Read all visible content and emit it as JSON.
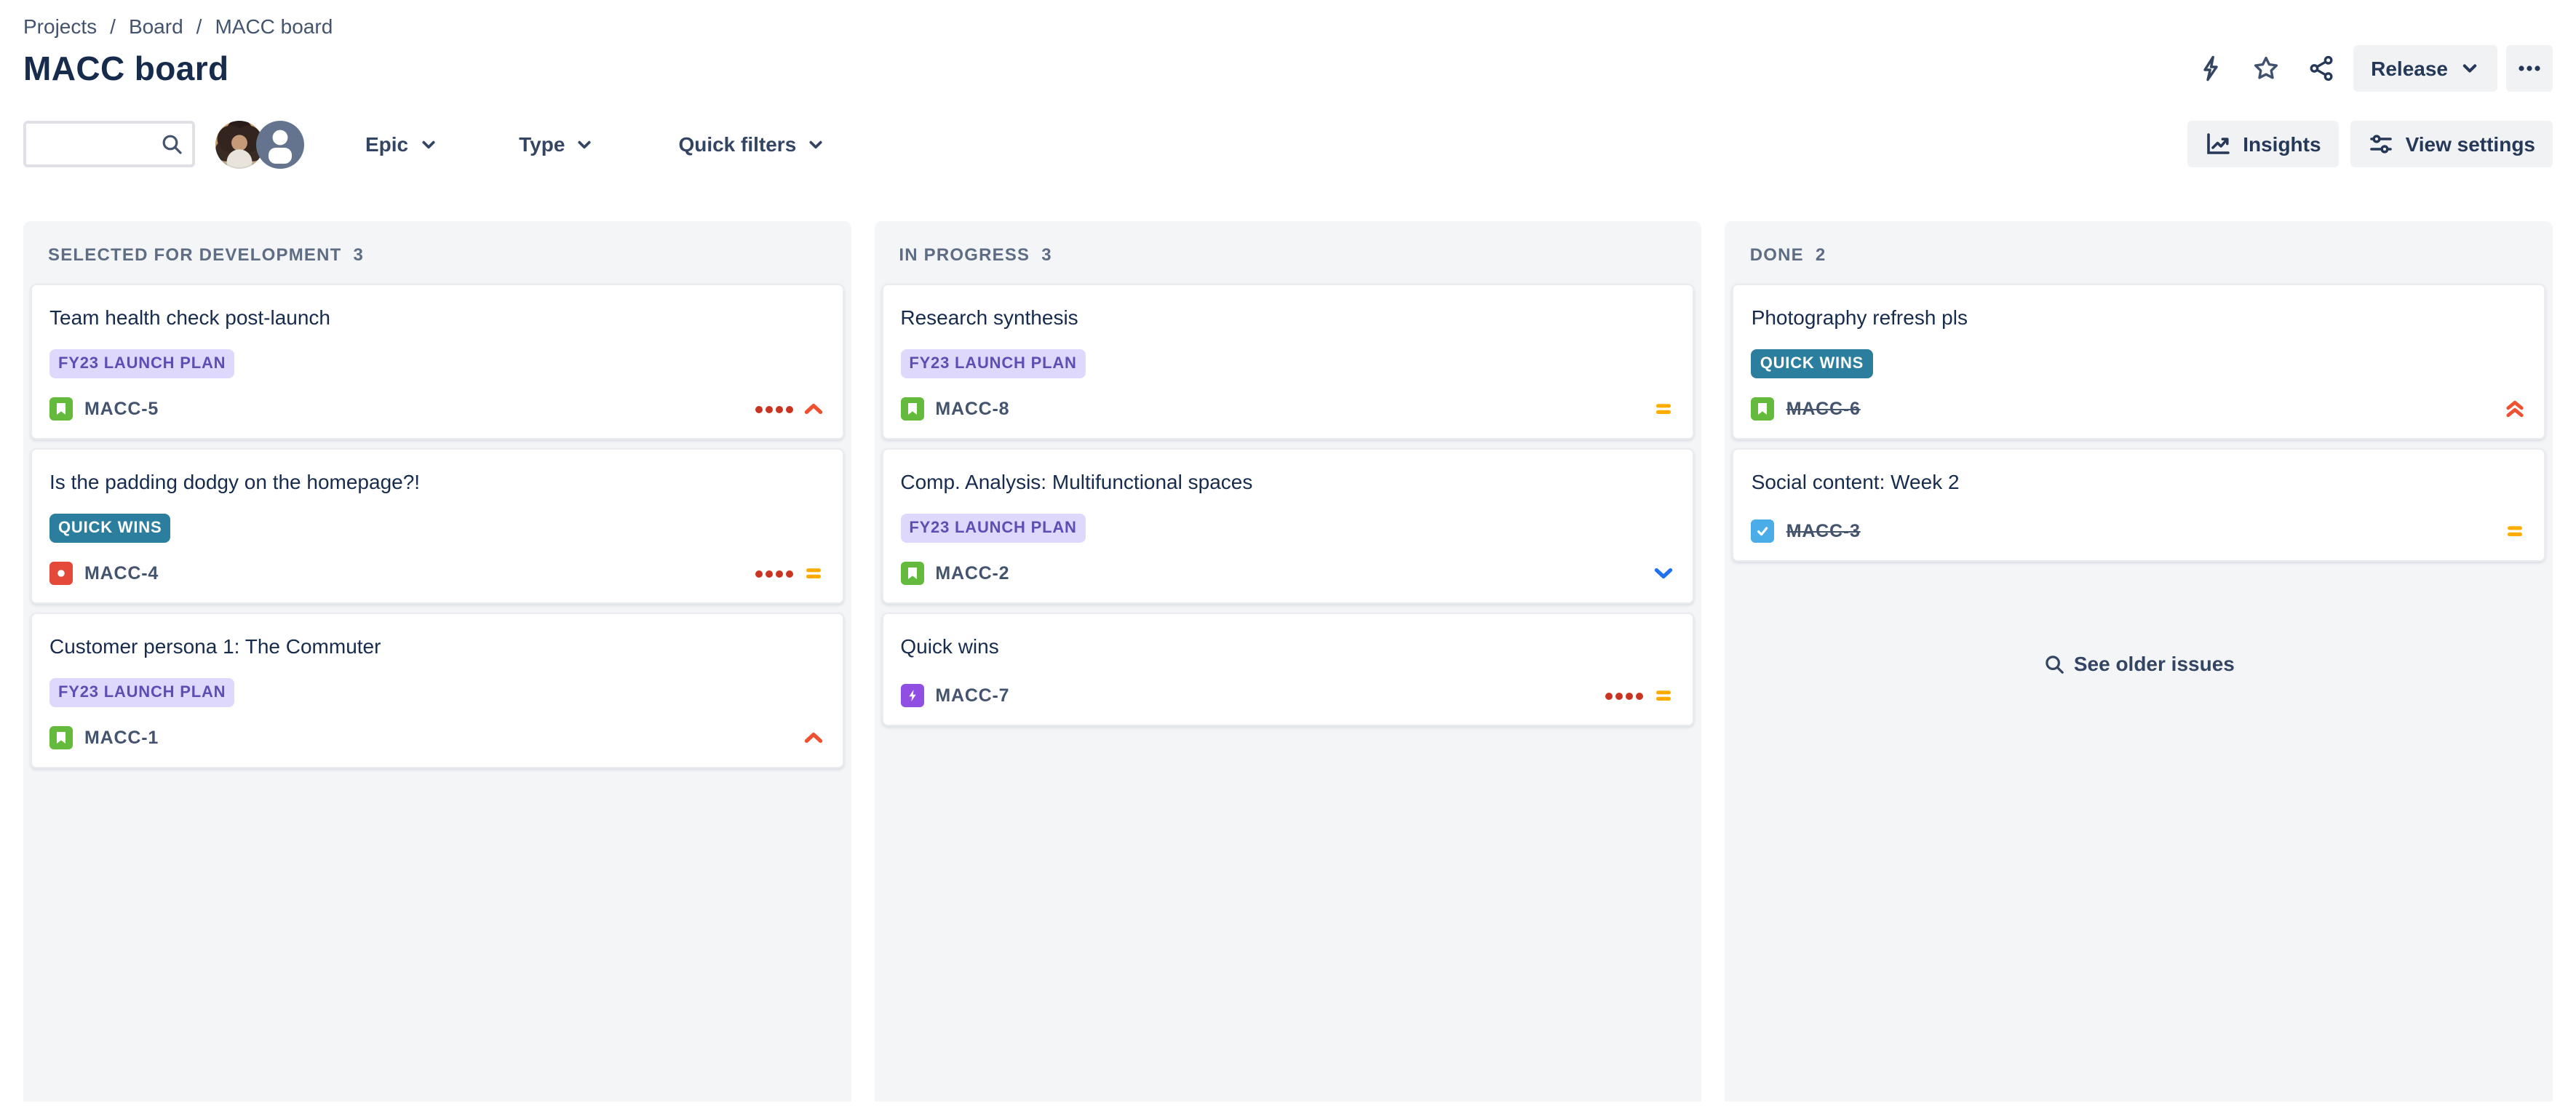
{
  "breadcrumb": {
    "separator": "/",
    "items": [
      "Projects",
      "Board",
      "MACC board"
    ]
  },
  "header": {
    "title": "MACC board",
    "release_button": "Release",
    "more_button": "•••",
    "icons": {
      "automation": "lightning-bolt",
      "favorite": "star-outline",
      "share": "share-nodes",
      "more": "ellipsis"
    }
  },
  "toolbar": {
    "search": {
      "value": "",
      "placeholder": ""
    },
    "search_icon": "magnifier",
    "avatars": [
      {
        "name": "user-photo-avatar"
      },
      {
        "name": "default-person-avatar"
      }
    ],
    "filters": [
      {
        "label": "Epic"
      },
      {
        "label": "Type"
      },
      {
        "label": "Quick filters"
      }
    ],
    "insights_button": "Insights",
    "view_settings_button": "View settings"
  },
  "board": {
    "columns": [
      {
        "title": "Selected for Development",
        "count": "3",
        "cards": [
          {
            "title": "Team health check post-launch",
            "epic_label": "FY23 LAUNCH PLAN",
            "epic_style": "purple",
            "key": "MACC-5",
            "type": "story",
            "days_in_column_dots": 4,
            "priority": "high",
            "done": false
          },
          {
            "title": "Is the padding dodgy on the homepage?!",
            "epic_label": "QUICK WINS",
            "epic_style": "teal",
            "key": "MACC-4",
            "type": "bug",
            "days_in_column_dots": 4,
            "priority": "medium",
            "done": false
          },
          {
            "title": "Customer persona 1: The Commuter",
            "epic_label": "FY23 LAUNCH PLAN",
            "epic_style": "purple",
            "key": "MACC-1",
            "type": "story",
            "days_in_column_dots": 0,
            "priority": "high",
            "done": false
          }
        ]
      },
      {
        "title": "In Progress",
        "count": "3",
        "cards": [
          {
            "title": "Research synthesis",
            "epic_label": "FY23 LAUNCH PLAN",
            "epic_style": "purple",
            "key": "MACC-8",
            "type": "story",
            "days_in_column_dots": 0,
            "priority": "medium",
            "done": false
          },
          {
            "title": "Comp. Analysis: Multifunctional spaces",
            "epic_label": "FY23 LAUNCH PLAN",
            "epic_style": "purple",
            "key": "MACC-2",
            "type": "story",
            "days_in_column_dots": 0,
            "priority": "low",
            "done": false
          },
          {
            "title": "Quick wins",
            "epic_label": null,
            "key": "MACC-7",
            "type": "epic",
            "days_in_column_dots": 4,
            "priority": "medium",
            "done": false
          }
        ]
      },
      {
        "title": "Done",
        "count": "2",
        "cards": [
          {
            "title": "Photography refresh pls",
            "epic_label": "QUICK WINS",
            "epic_style": "teal",
            "key": "MACC-6",
            "type": "story",
            "days_in_column_dots": 0,
            "priority": "highest",
            "done": true
          },
          {
            "title": "Social content: Week 2",
            "epic_label": null,
            "key": "MACC-3",
            "type": "task",
            "days_in_column_dots": 0,
            "priority": "medium",
            "done": true
          }
        ],
        "footer_link": "See older issues"
      }
    ]
  },
  "icon_legend": {
    "story": "green-bookmark-square",
    "bug": "red-circle-square",
    "epic": "purple-lightning-square",
    "task": "blue-check-square",
    "priority_high": "red-chevron-up",
    "priority_highest": "red-double-chevron-up",
    "priority_medium": "orange-equals-bars",
    "priority_low": "blue-chevron-down",
    "days_in_column": "red-dots"
  },
  "colors": {
    "title_text": "#172B4D",
    "muted_text": "#44546F",
    "column_bg": "#F4F5F7",
    "column_header_text": "#5E6C84",
    "button_bg": "#F1F2F4",
    "epic_purple_bg": "#DFD8FD",
    "epic_purple_text": "#5E4DB2",
    "epic_teal_bg": "#2B7E9E",
    "story_green": "#63BA3C",
    "bug_red": "#E5493A",
    "epic_purple_icon": "#904EE2",
    "task_blue": "#4BADE8",
    "priority_red": "#F0502F",
    "priority_orange": "#FFAB00",
    "priority_blue": "#2073F0",
    "dot_red": "#CA3521"
  }
}
